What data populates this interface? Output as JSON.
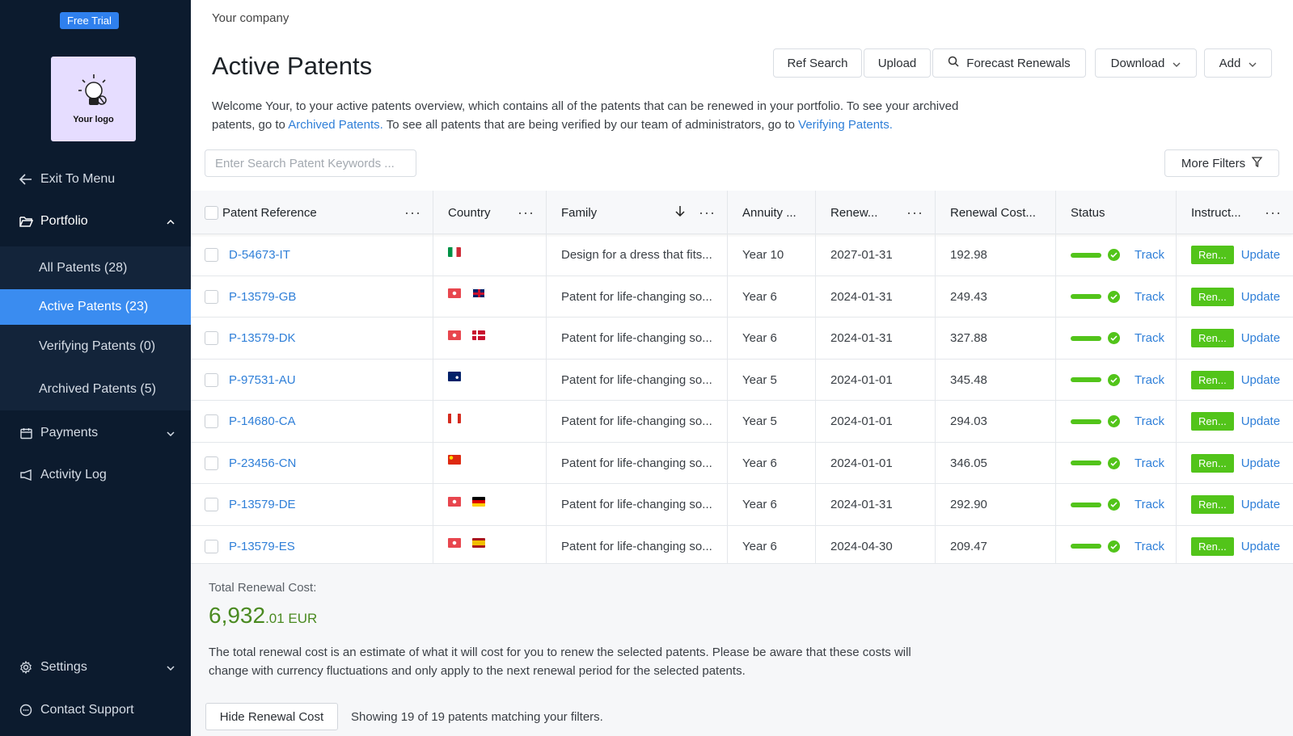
{
  "sidebar": {
    "trial_badge": "Free Trial",
    "logo_text": "Your logo",
    "exit": "Exit To Menu",
    "portfolio": "Portfolio",
    "sub_items": [
      "All Patents (28)",
      "Active Patents (23)",
      "Verifying Patents (0)",
      "Archived Patents (5)"
    ],
    "payments": "Payments",
    "activity": "Activity Log",
    "settings": "Settings",
    "support": "Contact Support"
  },
  "header": {
    "company": "Your company",
    "title": "Active Patents",
    "buttons": {
      "ref_search": "Ref Search",
      "upload": "Upload",
      "forecast": "Forecast Renewals",
      "download": "Download",
      "add": "Add"
    },
    "welcome_1": "Welcome Your, to your active patents overview, which contains all of the patents that can be renewed in your portfolio. To see your archived patents, go to ",
    "archived_link": "Archived Patents.",
    "welcome_2": " To see all patents that are being verified by our team of administrators, go to ",
    "verifying_link": "Verifying Patents."
  },
  "search": {
    "placeholder": "Enter Search Patent Keywords ..."
  },
  "more_filters": "More Filters",
  "table": {
    "columns": {
      "ref": "Patent Reference",
      "country": "Country",
      "family": "Family",
      "annuity": "Annuity ...",
      "renewal": "Renew...",
      "cost": "Renewal Cost...",
      "status": "Status",
      "instruct": "Instruct..."
    },
    "track_label": "Track",
    "renew_label": "Ren...",
    "update_label": "Update",
    "rows": [
      {
        "ref": "D-54673-IT",
        "flags": [
          "it"
        ],
        "family": "Design for a dress that fits...",
        "annuity": "Year 10",
        "date": "2027-01-31",
        "cost": "192.98"
      },
      {
        "ref": "P-13579-GB",
        "flags": [
          "ep",
          "gb"
        ],
        "family": "Patent for life-changing so...",
        "annuity": "Year 6",
        "date": "2024-01-31",
        "cost": "249.43"
      },
      {
        "ref": "P-13579-DK",
        "flags": [
          "ep",
          "dk"
        ],
        "family": "Patent for life-changing so...",
        "annuity": "Year 6",
        "date": "2024-01-31",
        "cost": "327.88"
      },
      {
        "ref": "P-97531-AU",
        "flags": [
          "au"
        ],
        "family": "Patent for life-changing so...",
        "annuity": "Year 5",
        "date": "2024-01-01",
        "cost": "345.48"
      },
      {
        "ref": "P-14680-CA",
        "flags": [
          "ca"
        ],
        "family": "Patent for life-changing so...",
        "annuity": "Year 5",
        "date": "2024-01-01",
        "cost": "294.03"
      },
      {
        "ref": "P-23456-CN",
        "flags": [
          "cn"
        ],
        "family": "Patent for life-changing so...",
        "annuity": "Year 6",
        "date": "2024-01-01",
        "cost": "346.05"
      },
      {
        "ref": "P-13579-DE",
        "flags": [
          "ep",
          "de"
        ],
        "family": "Patent for life-changing so...",
        "annuity": "Year 6",
        "date": "2024-01-31",
        "cost": "292.90"
      },
      {
        "ref": "P-13579-ES",
        "flags": [
          "ep",
          "es"
        ],
        "family": "Patent for life-changing so...",
        "annuity": "Year 6",
        "date": "2024-04-30",
        "cost": "209.47"
      }
    ]
  },
  "footer": {
    "total_label": "Total Renewal Cost:",
    "total_main": "6,932",
    "total_decimal": ".01 EUR",
    "note": "The total renewal cost is an estimate of what it will cost for you to renew the selected patents. Please be aware that these costs will change with currency fluctuations and only apply to the next renewal period for the selected patents.",
    "hide_button": "Hide Renewal Cost",
    "showing": "Showing 19 of 19 patents matching your filters."
  },
  "colors": {
    "sidebar_bg": "#0c1b2e",
    "accent": "#3a8cf0",
    "link": "#2f7fd8",
    "success": "#52c41a"
  }
}
